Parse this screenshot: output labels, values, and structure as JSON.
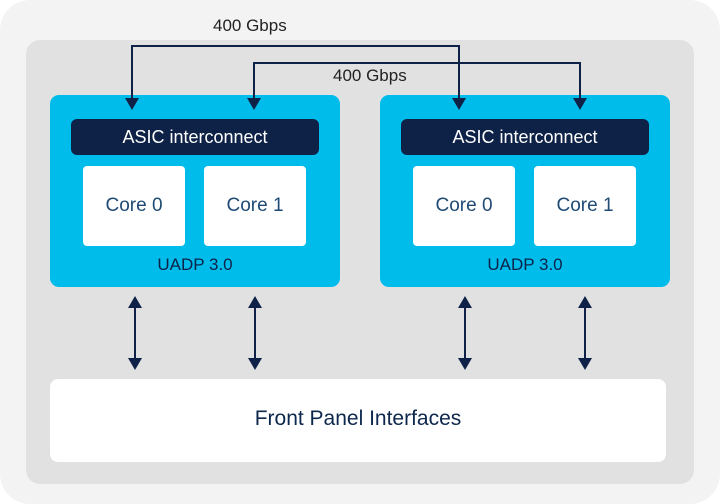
{
  "diagram": {
    "links": {
      "top_label": "400 Gbps",
      "second_label": "400 Gbps"
    },
    "asics": [
      {
        "interconnect_label": "ASIC interconnect",
        "cores": [
          "Core 0",
          "Core 1"
        ],
        "name": "UADP 3.0"
      },
      {
        "interconnect_label": "ASIC interconnect",
        "cores": [
          "Core 0",
          "Core 1"
        ],
        "name": "UADP 3.0"
      }
    ],
    "front_panel_label": "Front Panel Interfaces",
    "colors": {
      "asic_block": "#00bceb",
      "interconnect_bar": "#0e2248",
      "arrow": "#0e2248",
      "panel": "#e1e1e1"
    }
  }
}
